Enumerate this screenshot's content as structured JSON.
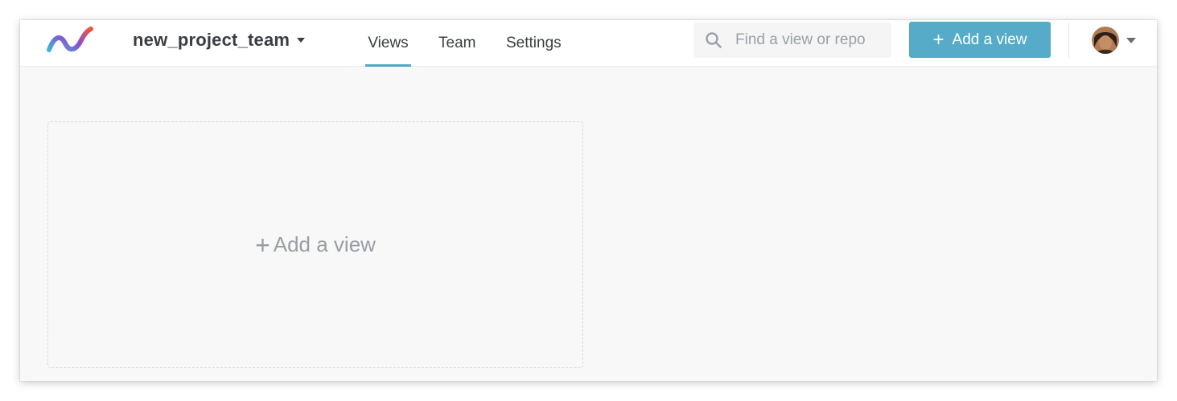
{
  "header": {
    "project_name": "new_project_team",
    "nav": {
      "views": "Views",
      "team": "Team",
      "settings": "Settings"
    },
    "search": {
      "placeholder": "Find a view or repo"
    },
    "add_view_button": {
      "icon": "+",
      "label": "Add a view"
    },
    "user_menu": {
      "avatar_icon": "user-avatar-icon"
    }
  },
  "main": {
    "add_view_card": {
      "icon": "+",
      "label": "Add a view"
    }
  },
  "colors": {
    "accent": "#55abc8",
    "active_tab_indicator": "#4fa9c5",
    "page_background": "#f8f8f8",
    "header_background": "#ffffff"
  }
}
